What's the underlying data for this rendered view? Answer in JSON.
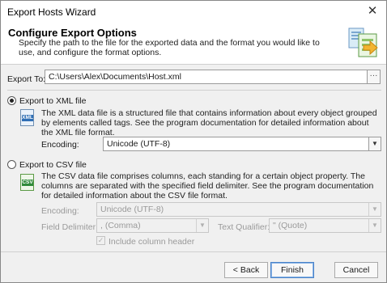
{
  "window": {
    "title": "Export Hosts Wizard",
    "close_glyph": "✕"
  },
  "header": {
    "title": "Configure Export Options",
    "description": "Specify the path to the file for the exported data and the format you would like to use, and configure the format options."
  },
  "export_to": {
    "label": "Export To:",
    "value": "C:\\Users\\Alex\\Documents\\Host.xml",
    "browse_glyph": "···"
  },
  "xml_option": {
    "label": "Export to XML file",
    "selected": true,
    "icon_text": "XML",
    "description": "The XML data file is a structured file that contains information about every object grouped by elements called tags. See the program documentation for detailed information about the XML file format.",
    "encoding_label": "Encoding:",
    "encoding_value": "Unicode (UTF-8)"
  },
  "csv_option": {
    "label": "Export to CSV file",
    "selected": false,
    "icon_text": "CSV",
    "description": "The CSV data file comprises columns, each standing for a certain object property. The columns are separated with the specified field delimiter. See the program documentation for detailed information about the CSV file format.",
    "encoding_label": "Encoding:",
    "encoding_value": "Unicode (UTF-8)",
    "delimiter_label": "Field Delimiter:",
    "delimiter_value": ", (Comma)",
    "qualifier_label": "Text Qualifier:",
    "qualifier_value": "\" (Quote)",
    "header_checkbox_label": "Include column header",
    "header_checked": true
  },
  "footer": {
    "back_label": "< Back",
    "finish_label": "Finish",
    "cancel_label": "Cancel"
  },
  "colors": {
    "accent": "#4a83c9",
    "xml_tag": "#2f6fb5",
    "csv_tag": "#2f8a3a"
  }
}
